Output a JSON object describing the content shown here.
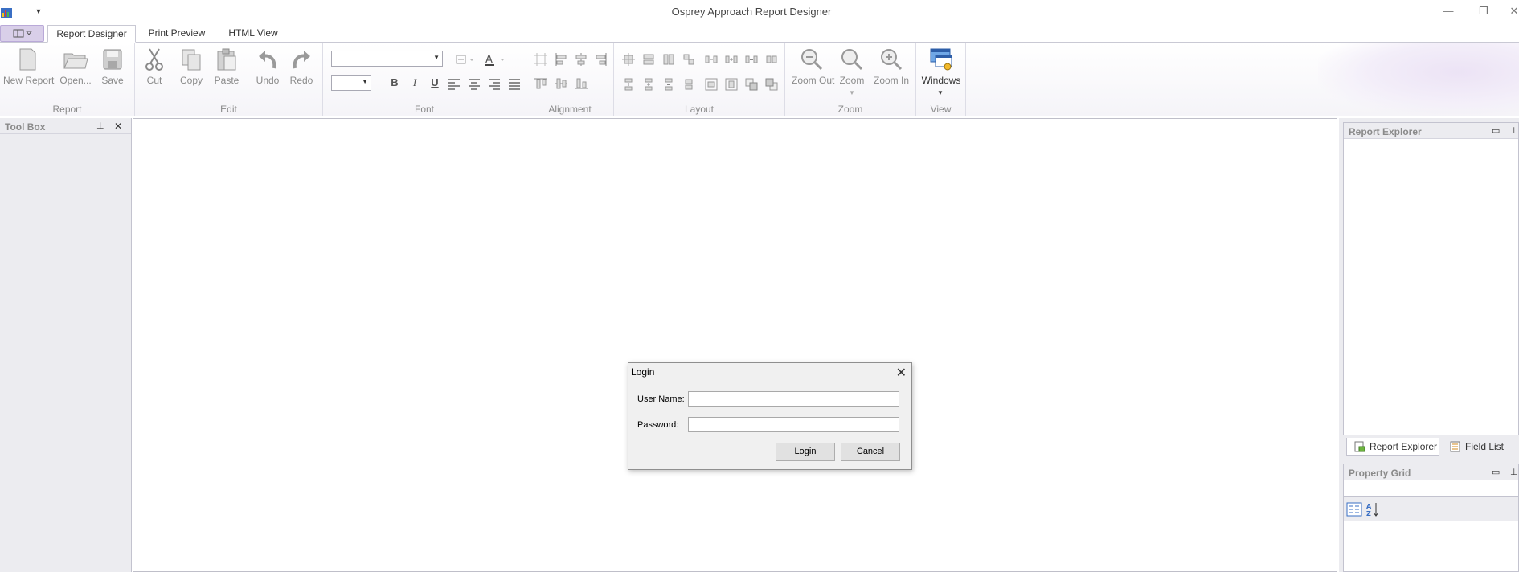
{
  "window": {
    "title": "Osprey Approach Report Designer",
    "minimize_icon": "minimize-icon",
    "restore_icon": "restore-icon",
    "close_icon": "close-icon"
  },
  "tabs": [
    {
      "label": "Report Designer",
      "active": true
    },
    {
      "label": "Print Preview",
      "active": false
    },
    {
      "label": "HTML View",
      "active": false
    }
  ],
  "ribbon": {
    "report_group": {
      "label": "Report",
      "new_report": "New Report",
      "open": "Open...",
      "save": "Save"
    },
    "edit_group": {
      "label": "Edit",
      "cut": "Cut",
      "copy": "Copy",
      "paste": "Paste",
      "undo": "Undo",
      "redo": "Redo"
    },
    "font_group": {
      "label": "Font",
      "font_name": "",
      "font_size": "",
      "bold": "B",
      "italic": "I",
      "underline": "U"
    },
    "alignment_group": {
      "label": "Alignment"
    },
    "layout_group": {
      "label": "Layout"
    },
    "zoom_group": {
      "label": "Zoom",
      "zoom_out": "Zoom Out",
      "zoom": "Zoom",
      "zoom_in": "Zoom In"
    },
    "view_group": {
      "label": "View",
      "windows": "Windows"
    }
  },
  "toolbox": {
    "title": "Tool Box",
    "pin_icon": "pin-icon",
    "close_icon": "close-icon"
  },
  "report_explorer": {
    "title": "Report Explorer"
  },
  "bottom_tabs": [
    {
      "label": "Report Explorer",
      "active": true
    },
    {
      "label": "Field List",
      "active": false
    }
  ],
  "property_grid": {
    "title": "Property Grid",
    "value": ""
  },
  "login_dialog": {
    "title": "Login",
    "username_label": "User Name:",
    "username_value": "",
    "password_label": "Password:",
    "password_value": "",
    "login_button": "Login",
    "cancel_button": "Cancel"
  }
}
